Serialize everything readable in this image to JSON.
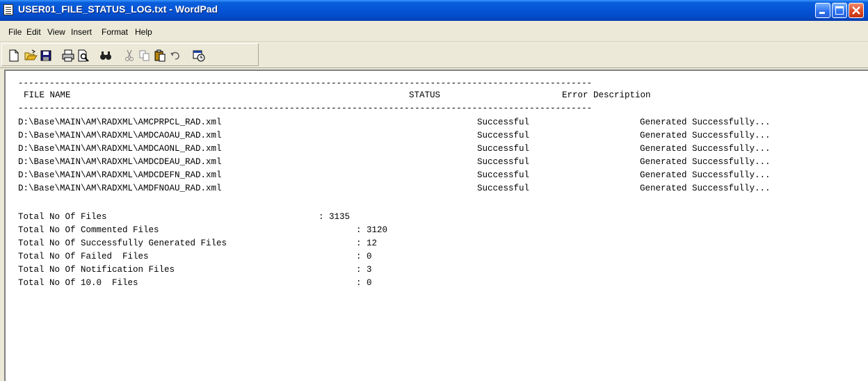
{
  "window": {
    "title": "USER01_FILE_STATUS_LOG.txt - WordPad"
  },
  "menu": [
    "File",
    "Edit",
    "View",
    "Insert",
    "Format",
    "Help"
  ],
  "toolbar": {
    "buttons": [
      "new-icon",
      "open-icon",
      "save-icon",
      "print-icon",
      "print-preview-icon",
      "find-icon",
      "cut-icon",
      "copy-icon",
      "paste-icon",
      "undo-icon",
      "date-time-icon"
    ]
  },
  "document": {
    "separator_top": "--------------------------------------------------------------------------------------------------------------",
    "header": {
      "file_name": "FILE NAME",
      "status": "STATUS",
      "error": "Error Description"
    },
    "separator_bottom": "--------------------------------------------------------------------------------------------------------------",
    "rows": [
      {
        "file": "D:\\Base\\MAIN\\AM\\RADXML\\AMCPRPCL_RAD.xml",
        "status": "Successful",
        "desc": "Generated Successfully..."
      },
      {
        "file": "D:\\Base\\MAIN\\AM\\RADXML\\AMDCAOAU_RAD.xml",
        "status": "Successful",
        "desc": "Generated Successfully..."
      },
      {
        "file": "D:\\Base\\MAIN\\AM\\RADXML\\AMDCAONL_RAD.xml",
        "status": "Successful",
        "desc": "Generated Successfully..."
      },
      {
        "file": "D:\\Base\\MAIN\\AM\\RADXML\\AMDCDEAU_RAD.xml",
        "status": "Successful",
        "desc": "Generated Successfully..."
      },
      {
        "file": "D:\\Base\\MAIN\\AM\\RADXML\\AMDCDEFN_RAD.xml",
        "status": "Successful",
        "desc": "Generated Successfully..."
      },
      {
        "file": "D:\\Base\\MAIN\\AM\\RADXML\\AMDFNOAU_RAD.xml",
        "status": "Successful",
        "desc": "Generated Successfully..."
      }
    ],
    "totals": [
      {
        "label": "Total No Of Files",
        "value": ": 3135"
      },
      {
        "label": "Total No Of Commented Files",
        "value": ": 3120"
      },
      {
        "label": "Total No Of Successfully Generated Files",
        "value": ": 12"
      },
      {
        "label": "Total No Of Failed  Files",
        "value": ": 0"
      },
      {
        "label": "Total No Of Notification Files",
        "value": ": 3"
      },
      {
        "label": "Total No Of 10.0  Files",
        "value": ": 0"
      }
    ]
  }
}
